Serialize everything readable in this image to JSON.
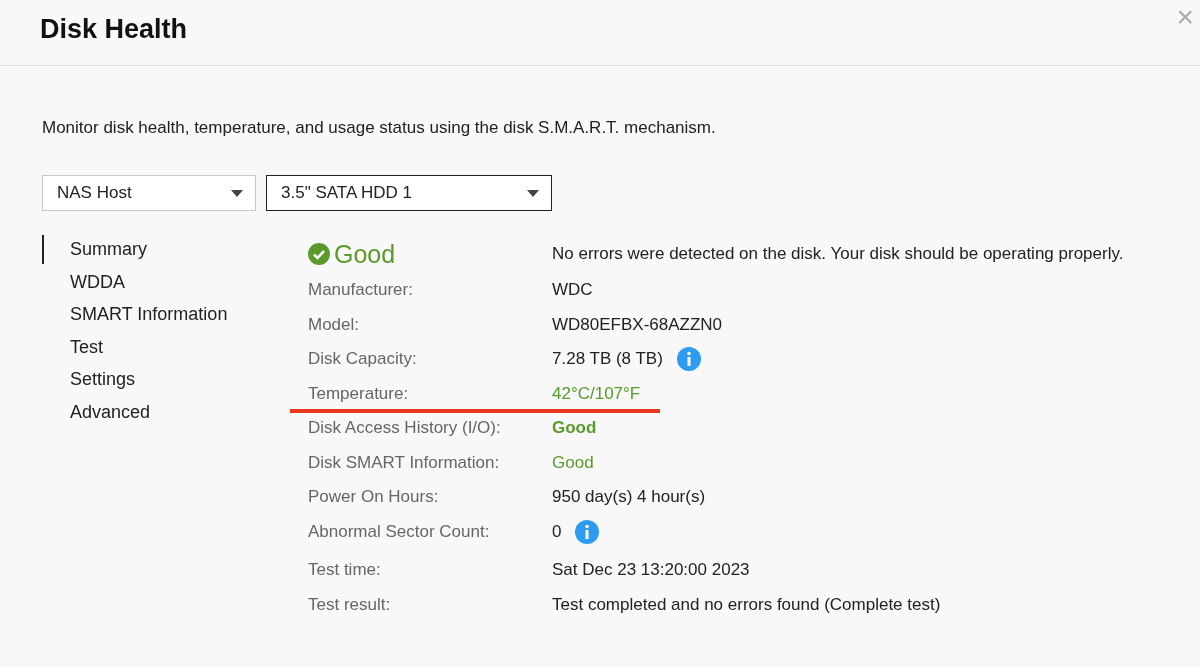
{
  "window": {
    "title": "Disk Health",
    "close": "×"
  },
  "description": "Monitor disk health, temperature, and usage status using the disk S.M.A.R.T. mechanism.",
  "dropdowns": [
    {
      "value": "NAS Host",
      "focused": false
    },
    {
      "value": "3.5\" SATA HDD 1",
      "focused": true
    }
  ],
  "sidebar": {
    "items": [
      {
        "label": "Summary",
        "selected": true
      },
      {
        "label": "WDDA",
        "selected": false
      },
      {
        "label": "SMART Information",
        "selected": false
      },
      {
        "label": "Test",
        "selected": false
      },
      {
        "label": "Settings",
        "selected": false
      },
      {
        "label": "Advanced",
        "selected": false
      }
    ]
  },
  "summary": {
    "status": "Good",
    "message": "No errors were detected on the disk. Your disk should be operating properly."
  },
  "details": [
    {
      "label": "Manufacturer:",
      "value": "WDC",
      "good": false,
      "bold": false,
      "info": false,
      "underlined": false
    },
    {
      "label": "Model:",
      "value": "WD80EFBX-68AZZN0",
      "good": false,
      "bold": false,
      "info": false,
      "underlined": false
    },
    {
      "label": "Disk Capacity:",
      "value": "7.28 TB (8 TB)",
      "good": false,
      "bold": false,
      "info": true,
      "underlined": false
    },
    {
      "label": "Temperature:",
      "value": "42°C/107°F",
      "good": true,
      "bold": false,
      "info": false,
      "underlined": true
    },
    {
      "label": "Disk Access History (I/O):",
      "value": "Good",
      "good": true,
      "bold": true,
      "info": false,
      "underlined": false
    },
    {
      "label": "Disk SMART Information:",
      "value": "Good",
      "good": true,
      "bold": false,
      "info": false,
      "underlined": false
    },
    {
      "label": "Power On Hours:",
      "value": "950 day(s) 4 hour(s)",
      "good": false,
      "bold": false,
      "info": false,
      "underlined": false
    },
    {
      "label": "Abnormal Sector Count:",
      "value": "0",
      "good": false,
      "bold": false,
      "info": true,
      "underlined": false
    },
    {
      "label": "Test time:",
      "value": "Sat Dec 23 13:20:00 2023",
      "good": false,
      "bold": false,
      "info": false,
      "underlined": false
    },
    {
      "label": "Test result:",
      "value": "Test completed and no errors found (Complete test)",
      "good": false,
      "bold": false,
      "info": false,
      "underlined": false
    }
  ]
}
